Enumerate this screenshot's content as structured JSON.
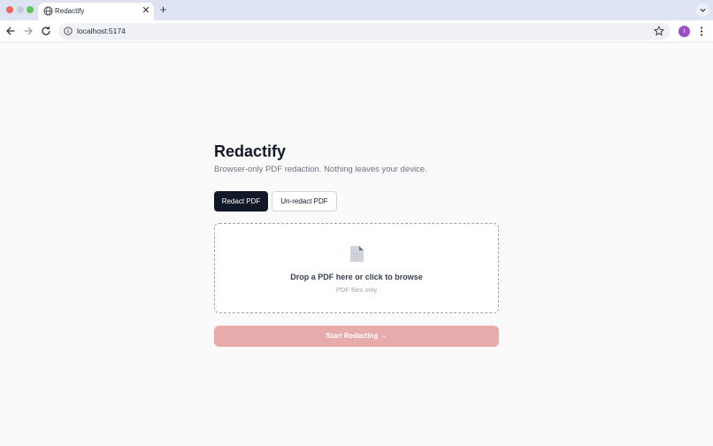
{
  "browser": {
    "tab": {
      "title": "Redactify",
      "favicon": "globe-icon"
    },
    "address_bar": {
      "url": "localhost:5174"
    },
    "profile_initial": "I",
    "colors": {
      "tabstrip": "#dde3f3",
      "profile": "#9b4fc8"
    }
  },
  "app": {
    "title": "Redactify",
    "subtitle": "Browser-only PDF redaction. Nothing leaves your device.",
    "modes": [
      {
        "label": "Redact PDF",
        "selected": true
      },
      {
        "label": "Un-redact PDF",
        "selected": false
      }
    ],
    "dropzone": {
      "icon": "file-icon",
      "title": "Drop a PDF here or click to browse",
      "hint": "PDF files only"
    },
    "start_button": {
      "label": "Start Redacting →",
      "disabled": true
    },
    "colors": {
      "primary": "#111827",
      "start_disabled": "#e8abab"
    }
  }
}
